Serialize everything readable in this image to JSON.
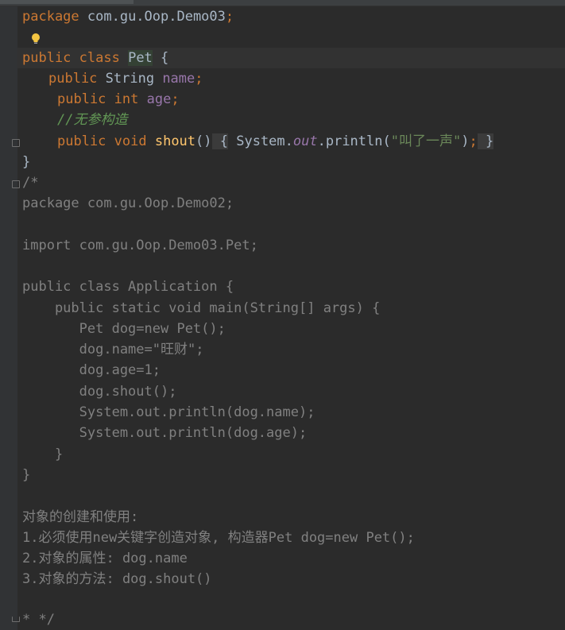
{
  "code": {
    "line1": {
      "kw": "package",
      "rest": " com.gu.Oop.Demo03",
      "semi": ";"
    },
    "line3": {
      "kw1": "public",
      "kw2": " class ",
      "cls": "Pet",
      "rest": " {"
    },
    "line4": {
      "kw1": "public",
      "type": " String ",
      "field": "name",
      "semi": ";"
    },
    "line5": {
      "kw1": "public",
      "type": " int ",
      "field": "age",
      "semi": ";"
    },
    "line6": {
      "comment": "//无参构造"
    },
    "line7": {
      "kw1": "public",
      "kw2": " void ",
      "fn": "shout",
      "paren": "()",
      "brace_open": " {",
      "sys": " System.",
      "out": "out",
      "println": ".println(",
      "str": "\"叫了一声\"",
      "close": ")",
      "semi": ";",
      "brace_close": " }"
    },
    "line8": {
      "text": "}"
    },
    "comment_lines": [
      "/*",
      "package com.gu.Oop.Demo02;",
      "",
      "import com.gu.Oop.Demo03.Pet;",
      "",
      "public class Application {",
      "    public static void main(String[] args) {",
      "       Pet dog=new Pet();",
      "       dog.name=\"旺财\";",
      "       dog.age=1;",
      "       dog.shout();",
      "       System.out.println(dog.name);",
      "       System.out.println(dog.age);",
      "    }",
      "}",
      "",
      "对象的创建和使用:",
      "1.必须使用new关键字创造对象, 构造器Pet dog=new Pet();",
      "2.对象的属性: dog.name",
      "3.对象的方法: dog.shout()",
      "",
      "* */"
    ]
  },
  "colors": {
    "background": "#2b2b2b",
    "keyword": "#cc7832",
    "field": "#9876aa",
    "function": "#ffc66d",
    "string": "#6a8759",
    "comment": "#808080",
    "doc_comment": "#629755"
  },
  "icons": {
    "intention_bulb": "lightbulb-icon",
    "fold": "fold-marker-icon"
  }
}
